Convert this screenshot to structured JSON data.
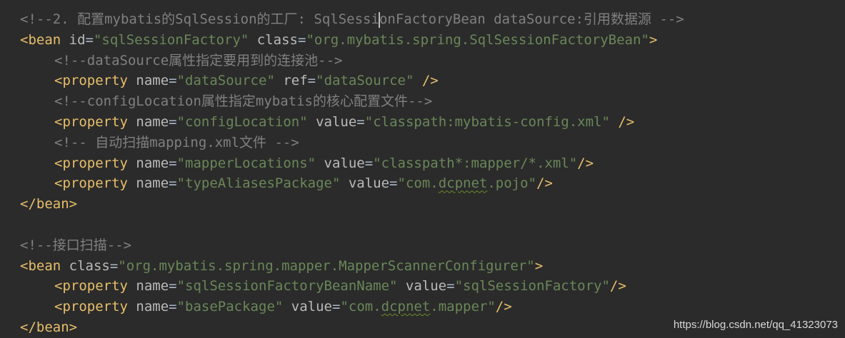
{
  "lines": [
    {
      "c1": "<!--2. 配置mybatis的SqlSession的工厂: SqlSessi",
      "c2": "onFactoryBean dataSource:引用数据源 -->"
    },
    {
      "open": "<bean ",
      "a1": "id",
      "v1": "\"sqlSessionFactory\"",
      "a2": "class",
      "v2": "\"org.mybatis.spring.SqlSessionFactoryBean\"",
      "close": ">"
    },
    {
      "comment": "<!--dataSource属性指定要用到的连接池-->"
    },
    {
      "open": "<property ",
      "a1": "name",
      "v1": "\"dataSource\"",
      "a2": "ref",
      "v2": "\"dataSource\"",
      "close": " />"
    },
    {
      "comment": "<!--configLocation属性指定mybatis的核心配置文件-->"
    },
    {
      "open": "<property ",
      "a1": "name",
      "v1": "\"configLocation\"",
      "a2": "value",
      "v2": "\"classpath:mybatis-config.xml\"",
      "close": " />"
    },
    {
      "comment": "<!-- 自动扫描mapping.xml文件 -->"
    },
    {
      "open": "<property ",
      "a1": "name",
      "v1": "\"mapperLocations\"",
      "a2": "value",
      "v2": "\"classpath*:mapper/*.xml\"",
      "close": "/>"
    },
    {
      "open": "<property ",
      "a1": "name",
      "v1": "\"typeAliasesPackage\"",
      "a2": "value",
      "v2a": "\"com.",
      "v2b": "dcpnet",
      "v2c": ".pojo\"",
      "close": "/>"
    },
    {
      "tag": "</bean>"
    },
    {
      "empty": ""
    },
    {
      "comment": "<!--接口扫描-->"
    },
    {
      "open": "<bean ",
      "a1": "class",
      "v1": "\"org.mybatis.spring.mapper.MapperScannerConfigurer\"",
      "close": ">"
    },
    {
      "open": "<property ",
      "a1": "name",
      "v1": "\"sqlSessionFactoryBeanName\"",
      "a2": "value",
      "v2": "\"sqlSessionFactory\"",
      "close": "/>"
    },
    {
      "open": "<property ",
      "a1": "name",
      "v1": "\"basePackage\"",
      "a2": "value",
      "v2a": "\"com.",
      "v2b": "dcpnet",
      "v2c": ".mapper\"",
      "close": "/>"
    },
    {
      "tag": "</bean>"
    }
  ],
  "watermark": "https://blog.csdn.net/qq_41323073",
  "colors": {
    "background": "#2b2b2b",
    "comment": "#808080",
    "tag": "#e8bf6a",
    "attribute": "#bababa",
    "value": "#6a8759"
  }
}
